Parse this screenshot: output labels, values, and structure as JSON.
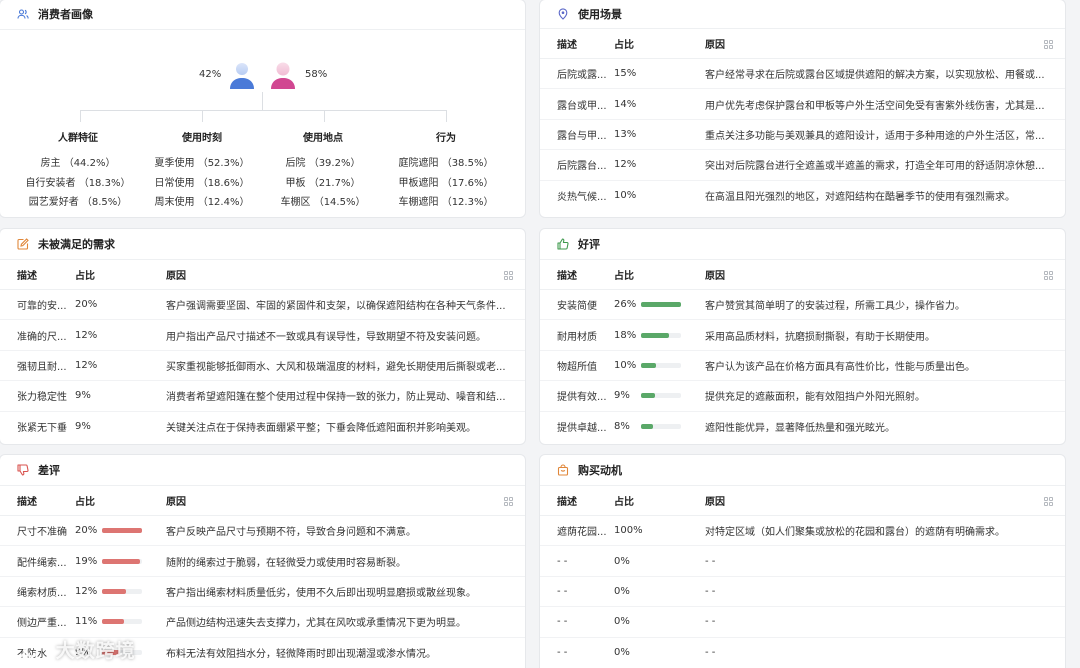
{
  "consumer": {
    "title": "消费者画像",
    "male_pct": "42%",
    "female_pct": "58%",
    "groups": [
      {
        "title": "人群特征",
        "items": [
          "房主 （44.2%）",
          "自行安装者 （18.3%）",
          "园艺爱好者 （8.5%）"
        ]
      },
      {
        "title": "使用时刻",
        "items": [
          "夏季使用 （52.3%）",
          "日常使用 （18.6%）",
          "周末使用 （12.4%）"
        ]
      },
      {
        "title": "使用地点",
        "items": [
          "后院 （39.2%）",
          "甲板 （21.7%）",
          "车棚区 （14.5%）"
        ]
      },
      {
        "title": "行为",
        "items": [
          "庭院遮阳 （38.5%）",
          "甲板遮阳 （17.6%）",
          "车棚遮阳 （12.3%）"
        ]
      }
    ]
  },
  "headers": {
    "desc": "描述",
    "pct": "占比",
    "reason": "原因"
  },
  "scenes": {
    "title": "使用场景",
    "rows": [
      {
        "desc": "后院或露...",
        "pct": "15%",
        "reason": "客户经常寻求在后院或露台区域提供遮阳的解决方案，以实现放松、用餐或..."
      },
      {
        "desc": "露台或甲...",
        "pct": "14%",
        "reason": "用户优先考虑保护露台和甲板等户外生活空间免受有害紫外线伤害，尤其是..."
      },
      {
        "desc": "露台与甲...",
        "pct": "13%",
        "reason": "重点关注多功能与美观兼具的遮阳设计，适用于多种用途的户外生活区，常..."
      },
      {
        "desc": "后院露台...",
        "pct": "12%",
        "reason": "突出对后院露台进行全遮盖或半遮盖的需求，打造全年可用的舒适阴凉休憩..."
      },
      {
        "desc": "炎热气候...",
        "pct": "10%",
        "reason": "在高温且阳光强烈的地区，对遮阳结构在酷暑季节的使用有强烈需求。"
      }
    ]
  },
  "unmet": {
    "title": "未被满足的需求",
    "rows": [
      {
        "desc": "可靠的安...",
        "pct": "20%",
        "reason": "客户强调需要坚固、牢固的紧固件和支架，以确保遮阳结构在各种天气条件..."
      },
      {
        "desc": "准确的尺...",
        "pct": "12%",
        "reason": "用户指出产品尺寸描述不一致或具有误导性，导致期望不符及安装问题。"
      },
      {
        "desc": "强韧且耐...",
        "pct": "12%",
        "reason": "买家重视能够抵御雨水、大风和极端温度的材料，避免长期使用后撕裂或老..."
      },
      {
        "desc": "张力稳定性",
        "pct": "9%",
        "reason": "消费者希望遮阳篷在整个使用过程中保持一致的张力，防止晃动、噪音和结..."
      },
      {
        "desc": "张紧无下垂",
        "pct": "9%",
        "reason": "关键关注点在于保持表面绷紧平整；下垂会降低遮阳面积并影响美观。"
      }
    ]
  },
  "positive": {
    "title": "好评",
    "rows": [
      {
        "desc": "安装简便",
        "pct": "26%",
        "value": 26,
        "reason": "客户赞赏其简单明了的安装过程，所需工具少，操作省力。"
      },
      {
        "desc": "耐用材质",
        "pct": "18%",
        "value": 18,
        "reason": "采用高品质材料，抗磨损耐撕裂，有助于长期使用。"
      },
      {
        "desc": "物超所值",
        "pct": "10%",
        "value": 10,
        "reason": "客户认为该产品在价格方面具有高性价比，性能与质量出色。"
      },
      {
        "desc": "提供有效...",
        "pct": "9%",
        "value": 9,
        "reason": "提供充足的遮蔽面积，能有效阻挡户外阳光照射。"
      },
      {
        "desc": "提供卓越...",
        "pct": "8%",
        "value": 8,
        "reason": "遮阳性能优异，显著降低热量和强光眩光。"
      }
    ]
  },
  "negative": {
    "title": "差评",
    "rows": [
      {
        "desc": "尺寸不准确",
        "pct": "20%",
        "value": 20,
        "reason": "客户反映产品尺寸与预期不符，导致合身问题和不满意。"
      },
      {
        "desc": "配件绳索...",
        "pct": "19%",
        "value": 19,
        "reason": "随附的绳索过于脆弱，在轻微受力或使用时容易断裂。"
      },
      {
        "desc": "绳索材质...",
        "pct": "12%",
        "value": 12,
        "reason": "客户指出绳索材料质量低劣，使用不久后即出现明显磨损或散丝现象。"
      },
      {
        "desc": "侧边严重...",
        "pct": "11%",
        "value": 11,
        "reason": "产品侧边结构迅速失去支撑力，尤其在风吹或承重情况下更为明显。"
      },
      {
        "desc": "不防水",
        "pct": "9%",
        "value": 9,
        "reason": "布料无法有效阻挡水分，轻微降雨时即出现潮湿或渗水情况。"
      }
    ]
  },
  "motivation": {
    "title": "购买动机",
    "rows": [
      {
        "desc": "遮荫花园...",
        "pct": "100%",
        "reason": "对特定区域（如人们聚集或放松的花园和露台）的遮荫有明确需求。"
      },
      {
        "desc": "- -",
        "pct": "0%",
        "reason": "- -"
      },
      {
        "desc": "- -",
        "pct": "0%",
        "reason": "- -"
      },
      {
        "desc": "- -",
        "pct": "0%",
        "reason": "- -"
      },
      {
        "desc": "- -",
        "pct": "0%",
        "reason": "- -"
      }
    ]
  },
  "watermark": "大数跨境",
  "colors": {
    "positive_bar": "#5aa868",
    "negative_bar": "#dd7572",
    "male": "#4a7ad8",
    "female": "#d14791"
  }
}
